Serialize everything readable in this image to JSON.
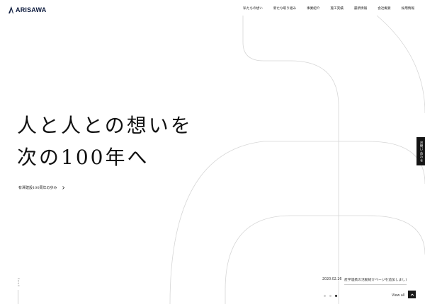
{
  "brand": {
    "name": "ARISAWA"
  },
  "nav": {
    "items": [
      {
        "label": "私たちの想い"
      },
      {
        "label": "新たな取り組み"
      },
      {
        "label": "事業紹介"
      },
      {
        "label": "施工実績"
      },
      {
        "label": "最新情報"
      },
      {
        "label": "会社概要"
      },
      {
        "label": "採用情報"
      }
    ]
  },
  "hero": {
    "line1": "人と人との想いを",
    "line2": "次の100年へ"
  },
  "history_link": {
    "label": "有澤建設100周年の歩み"
  },
  "side_tab": {
    "label": "お問い合わせ"
  },
  "scroll": {
    "label": "Scroll"
  },
  "news": {
    "date": "2020.02.26",
    "title": "産学連携の活動紹介ページを追加しました。",
    "view_all": "View all",
    "slides_total": 3,
    "slide_active": 3
  },
  "colors": {
    "accent": "#1a1a1a",
    "brand": "#0d1b3e",
    "line": "#d6d6d6"
  }
}
